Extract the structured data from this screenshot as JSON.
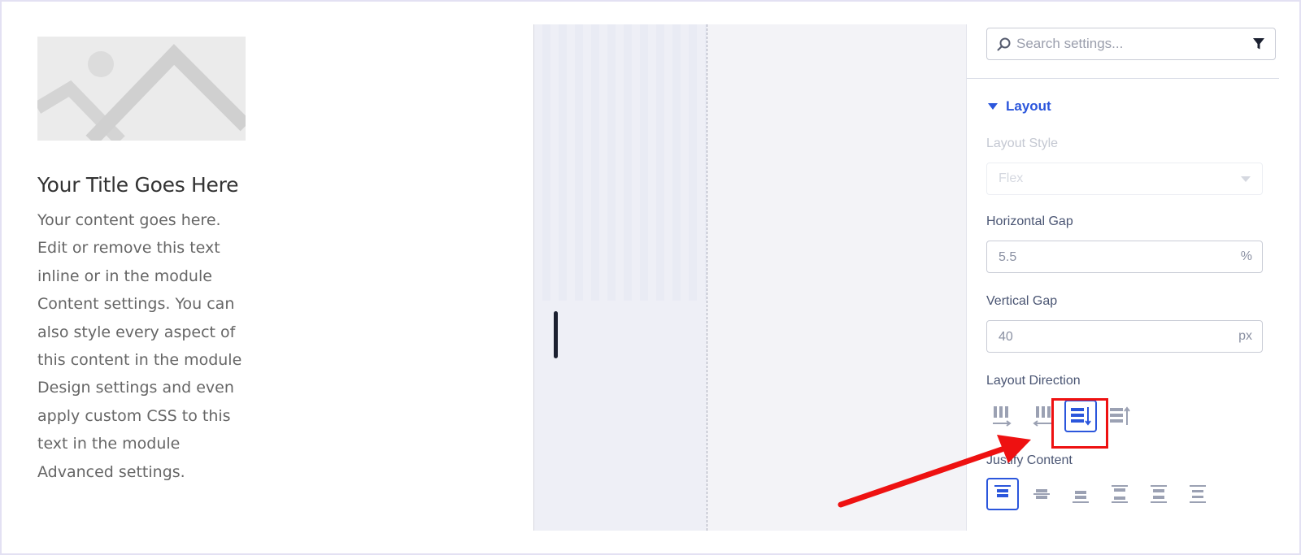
{
  "blurb": {
    "title": "Your Title Goes Here",
    "body": "Your content goes here. Edit or remove this text inline or in the module Content settings. You can also style every aspect of this content in the module Design settings and even apply custom CSS to this text in the module Advanced settings."
  },
  "settings": {
    "search_placeholder": "Search settings...",
    "section_title": "Layout",
    "layout_style": {
      "label": "Layout Style",
      "value": "Flex"
    },
    "horizontal_gap": {
      "label": "Horizontal Gap",
      "value": "5.5",
      "unit": "%"
    },
    "vertical_gap": {
      "label": "Vertical Gap",
      "value": "40",
      "unit": "px"
    },
    "layout_direction": {
      "label": "Layout Direction",
      "options": [
        "row-icon",
        "row-reverse-icon",
        "column-icon",
        "column-reverse-icon"
      ],
      "selected": "column-icon"
    },
    "justify_content": {
      "label": "Justify Content",
      "options": [
        "justify-start-icon",
        "justify-center-icon",
        "justify-end-icon",
        "justify-space-between-icon",
        "justify-space-around-icon",
        "justify-space-evenly-icon"
      ],
      "selected": "justify-start-icon"
    }
  },
  "colors": {
    "accent": "#2b56dc",
    "icon_inactive": "#9ba1b3",
    "annotation": "#ee1111"
  }
}
